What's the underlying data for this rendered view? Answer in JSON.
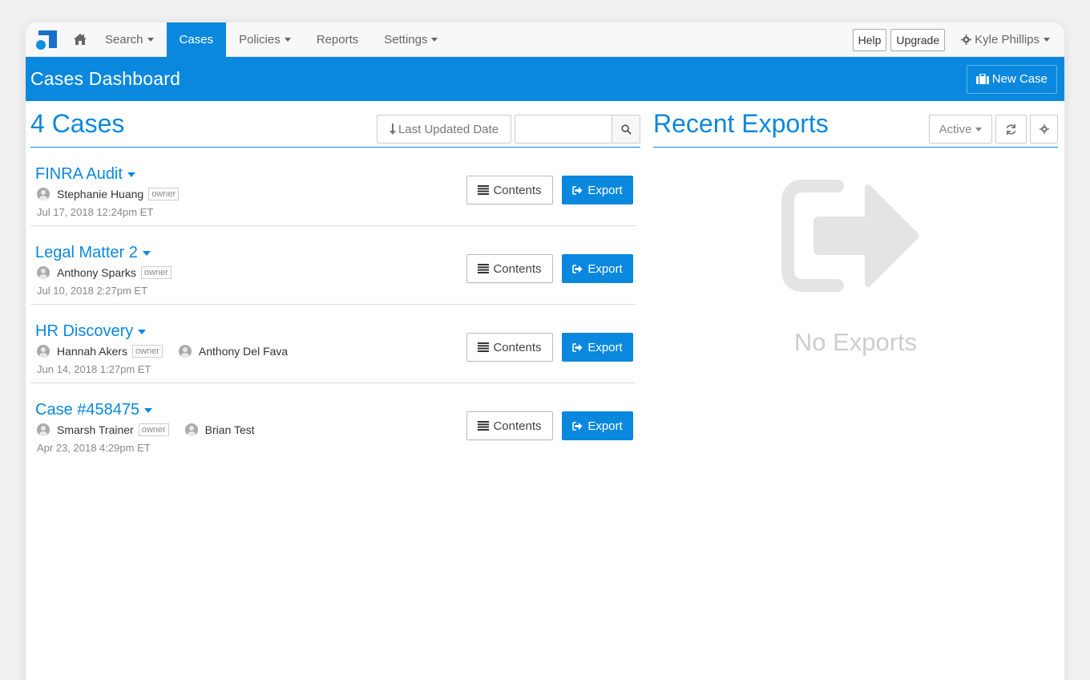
{
  "nav": {
    "items": [
      {
        "label": "Search",
        "caret": true,
        "active": false
      },
      {
        "label": "Cases",
        "caret": false,
        "active": true
      },
      {
        "label": "Policies",
        "caret": true,
        "active": false
      },
      {
        "label": "Reports",
        "caret": false,
        "active": false
      },
      {
        "label": "Settings",
        "caret": true,
        "active": false
      }
    ],
    "help_label": "Help",
    "upgrade_label": "Upgrade",
    "user_name": "Kyle Phillips"
  },
  "header": {
    "title": "Cases Dashboard",
    "new_case_label": "New Case"
  },
  "cases_panel": {
    "title": "4 Cases",
    "sort_label": "Last Updated Date",
    "search_value": "",
    "contents_label": "Contents",
    "export_label": "Export",
    "owner_tag": "owner",
    "cases": [
      {
        "name": "FINRA Audit",
        "members": [
          {
            "name": "Stephanie Huang",
            "owner": true
          }
        ],
        "date": "Jul 17, 2018 12:24pm ET"
      },
      {
        "name": "Legal Matter 2",
        "members": [
          {
            "name": "Anthony Sparks",
            "owner": true
          }
        ],
        "date": "Jul 10, 2018 2:27pm ET"
      },
      {
        "name": "HR Discovery",
        "members": [
          {
            "name": "Hannah Akers",
            "owner": true
          },
          {
            "name": "Anthony Del Fava",
            "owner": false
          }
        ],
        "date": "Jun 14, 2018 1:27pm ET"
      },
      {
        "name": "Case #458475",
        "members": [
          {
            "name": "Smarsh Trainer",
            "owner": true
          },
          {
            "name": "Brian Test",
            "owner": false
          }
        ],
        "date": "Apr 23, 2018 4:29pm ET"
      }
    ]
  },
  "exports_panel": {
    "title": "Recent Exports",
    "filter_label": "Active",
    "empty_text": "No Exports"
  },
  "colors": {
    "accent": "#0a88dd",
    "muted": "#cdcdcd"
  }
}
